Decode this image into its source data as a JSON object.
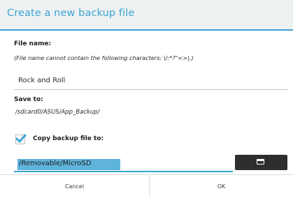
{
  "dialog": {
    "title": "Create a new backup file",
    "accent_color": "#3aa4d2"
  },
  "file_name": {
    "label": "File name:",
    "hint": "(File name cannot contain the following characters: \\/:*?\"<>|.)",
    "value": "Rock and Roll"
  },
  "save_to": {
    "label": "Save to:",
    "path": "/sdcard0/ASUS/App_Backup/"
  },
  "copy": {
    "checked": true,
    "label": "Copy backup file to:",
    "value": "/Removable/MicroSD",
    "browse_icon": "folder-icon"
  },
  "buttons": {
    "cancel": "Cancel",
    "ok": "OK"
  }
}
